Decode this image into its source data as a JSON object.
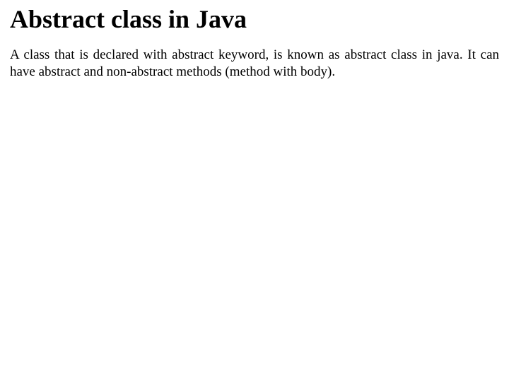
{
  "document": {
    "title": "Abstract class in Java",
    "paragraph": "A class that is declared with abstract keyword, is known as abstract class in java. It can have abstract and non-abstract methods (method with body)."
  }
}
